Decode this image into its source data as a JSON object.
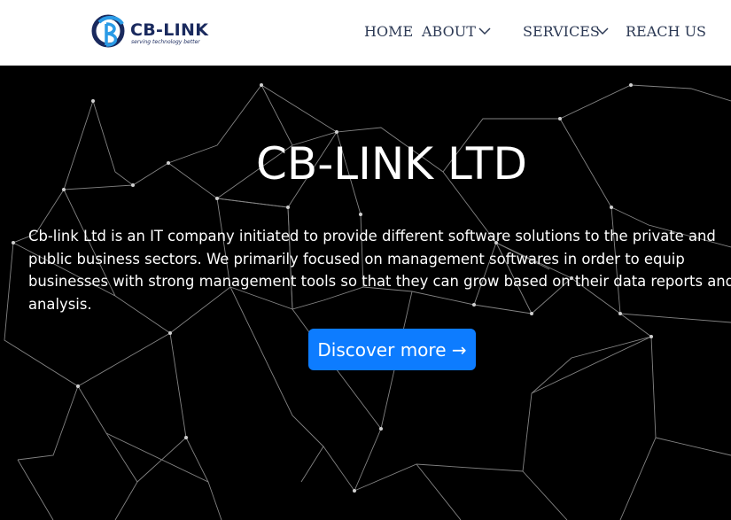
{
  "brand": {
    "name": "CB-LINK",
    "tagline": "serving technology better"
  },
  "nav": {
    "home": "HOME",
    "about": "ABOUT",
    "services": "SERVICES",
    "reach": "REACH US"
  },
  "hero": {
    "title": "CB-LINK LTD",
    "description": "Cb-link Ltd is an IT company initiated to provide different software solutions to the private and public business sectors. We primarily focused on management softwares in order to equip businesses with strong management tools so that they can grow based on their data reports and analysis.",
    "cta": "Discover more →"
  },
  "colors": {
    "accent": "#0d7cff",
    "brand": "#1a2a5e",
    "nav_text": "#2d3a55",
    "hero_bg": "#000000"
  }
}
